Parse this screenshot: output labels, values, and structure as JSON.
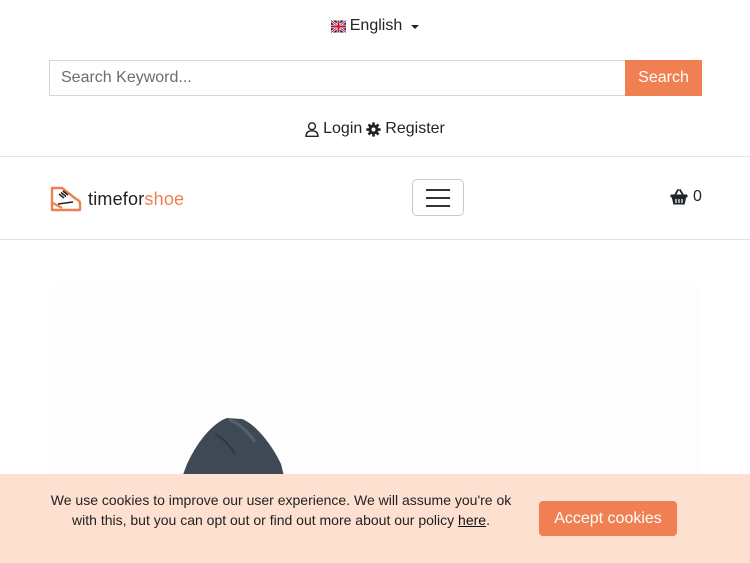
{
  "language": {
    "label": "English",
    "flag_icon": "uk-flag-icon"
  },
  "search": {
    "placeholder": "Search Keyword...",
    "button_label": "Search"
  },
  "auth": {
    "login_label": "Login",
    "register_label": "Register"
  },
  "logo": {
    "part1": "timefor",
    "part2": "shoe"
  },
  "cart": {
    "count": "0",
    "icon": "basket-icon"
  },
  "cookies": {
    "message": "We use cookies to improve our user experience. We will assume you're ok with this, but you can opt out or find out more about our policy",
    "link_label": "here",
    "suffix": ".",
    "accept_label": "Accept cookies"
  },
  "colors": {
    "accent": "#f07f52",
    "cookie_background": "#fde0cf"
  }
}
